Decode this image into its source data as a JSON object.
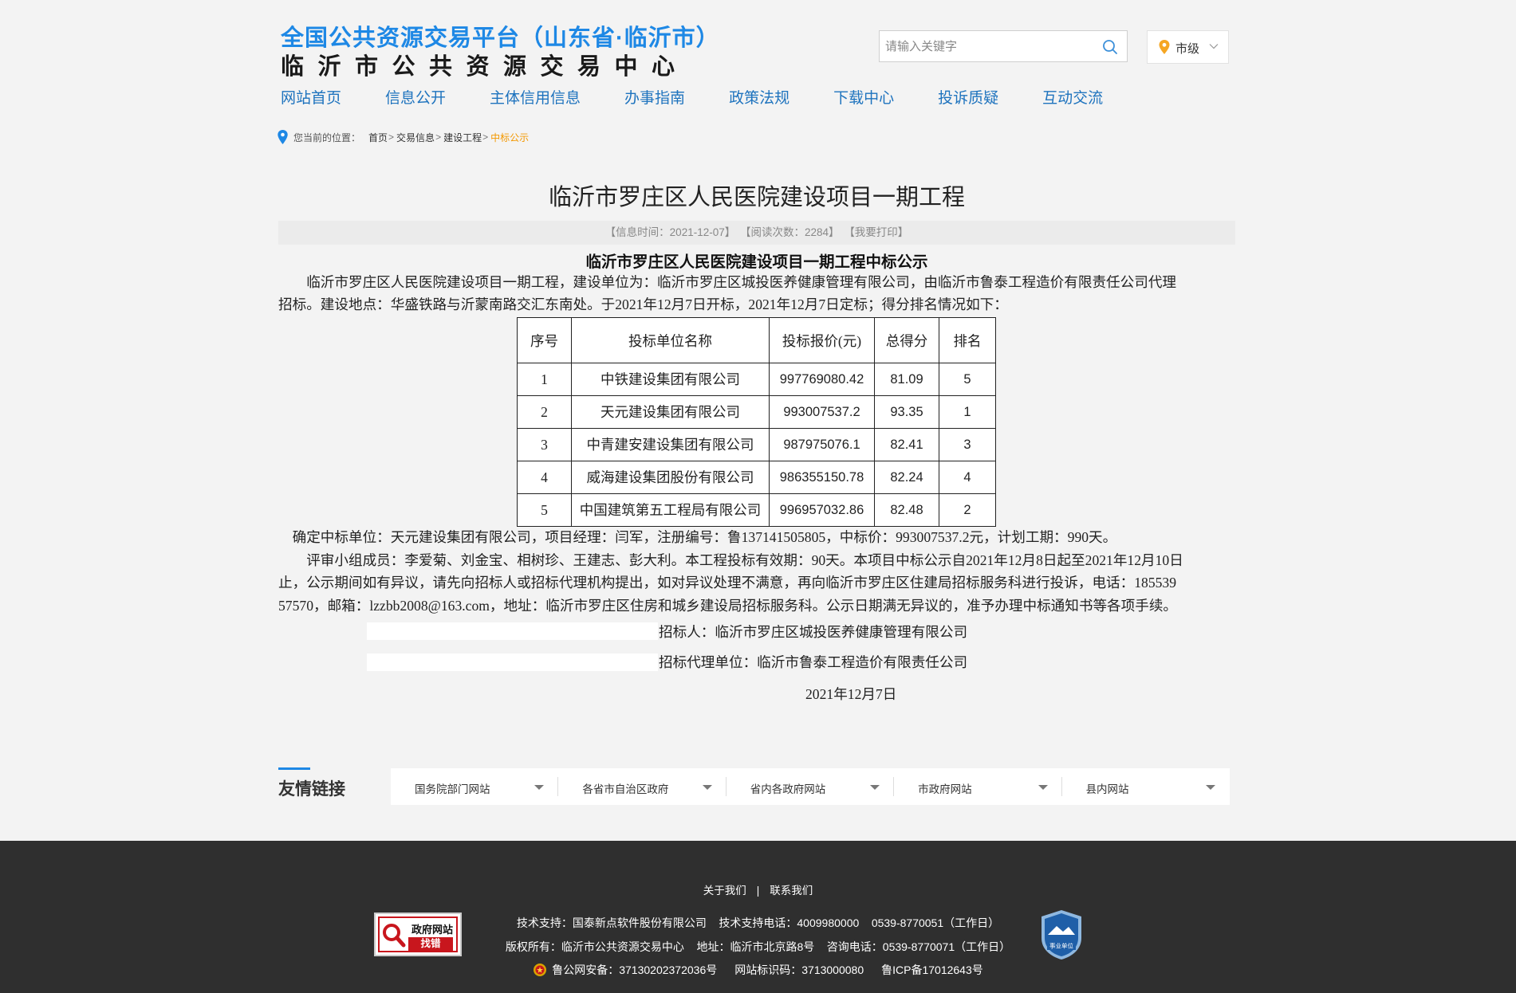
{
  "header": {
    "title_line1": "全国公共资源交易平台（山东省·临沂市）",
    "title_line2": "临沂市公共资源交易中心",
    "search_placeholder": "请输入关键字",
    "city_select": "市级"
  },
  "nav": [
    "网站首页",
    "信息公开",
    "主体信用信息",
    "办事指南",
    "政策法规",
    "下载中心",
    "投诉质疑",
    "互动交流"
  ],
  "breadcrumb": {
    "prefix": "您当前的位置：",
    "items": [
      "首页",
      "交易信息",
      "建设工程"
    ],
    "current": "中标公示"
  },
  "article": {
    "title": "临沂市罗庄区人民医院建设项目一期工程",
    "meta_time": "【信息时间：2021-12-07】",
    "meta_reads": "【阅读次数：2284】",
    "meta_print": "【我要打印】",
    "notice_title": "临沂市罗庄区人民医院建设项目一期工程中标公示",
    "para1_line1": "　　临沂市罗庄区人民医院建设项目一期工程，建设单位为：临沂市罗庄区城投医养健康管理有限公司，由临沂市鲁泰工程造价有限责任公司代理",
    "para1_line2": "招标。建设地点：华盛铁路与沂蒙南路交汇东南处。于2021年12月7日开标，2021年12月7日定标；得分排名情况如下：",
    "table": {
      "headers": [
        "序号",
        "投标单位名称",
        "投标报价(元)",
        "总得分",
        "排名"
      ],
      "rows": [
        [
          "1",
          "中铁建设集团有限公司",
          "997769080.42",
          "81.09",
          "5"
        ],
        [
          "2",
          "天元建设集团有限公司",
          "993007537.2",
          "93.35",
          "1"
        ],
        [
          "3",
          "中青建安建设集团有限公司",
          "987975076.1",
          "82.41",
          "3"
        ],
        [
          "4",
          "威海建设集团股份有限公司",
          "986355150.78",
          "82.24",
          "4"
        ],
        [
          "5",
          "中国建筑第五工程局有限公司",
          "996957032.86",
          "82.48",
          "2"
        ]
      ]
    },
    "winner_line": "　确定中标单位：天元建设集团有限公司，项目经理：闫军，注册编号：鲁137141505805，中标价：993007537.2元，计划工期：990天。",
    "review_line1": "　　评审小组成员：李爱菊、刘金宝、相树珍、王建志、彭大利。本工程投标有效期：90天。本项目中标公示自2021年12月8日起至2021年12月10日",
    "review_line2": "止，公示期间如有异议，请先向招标人或招标代理机构提出，如对异议处理不满意，再向临沂市罗庄区住建局招标服务科进行投诉，电话：185539",
    "review_line3": "57570，邮箱：lzzbb2008@163.com，地址：临沂市罗庄区住房和城乡建设局招标服务科。公示日期满无异议的，准予办理中标通知书等各项手续。",
    "tenderer": "招标人：临沂市罗庄区城投医养健康管理有限公司",
    "agent": "招标代理单位：临沂市鲁泰工程造价有限责任公司",
    "date": "2021年12月7日"
  },
  "links": {
    "title": "友情链接",
    "selects": [
      "国务院部门网站",
      "各省市自治区政府",
      "省内各政府网站",
      "市政府网站",
      "县内网站"
    ]
  },
  "footer": {
    "about": "关于我们",
    "contact": "联系我们",
    "tech_support": "技术支持：国泰新点软件股份有限公司    技术支持电话：4009980000    0539-8770051（工作日）",
    "copyright": "版权所有：临沂市公共资源交易中心    地址：临沂市北京路8号    咨询电话：0539-8770071（工作日）",
    "police_record": "鲁公网安备：37130202372036号",
    "site_code": "网站标识码：3713000080",
    "icp": "鲁ICP备17012643号",
    "gov_badge_line1": "政府网站",
    "gov_badge_line2": "找错",
    "shiye_label": "事业单位"
  },
  "colors": {
    "brand_blue": "#1e88e5",
    "nav_blue": "#1e73be",
    "accent_orange": "#f39800",
    "footer_bg": "#2f2f2f",
    "badge_red": "#c8161d"
  }
}
